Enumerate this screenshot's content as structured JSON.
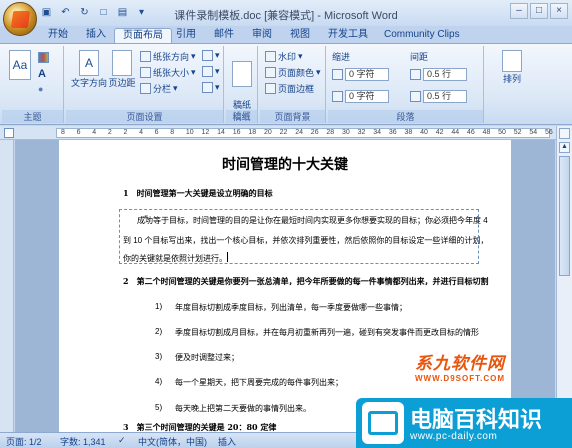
{
  "window": {
    "title": "课件录制模板.doc [兼容模式] - Microsoft Word",
    "controls": [
      "–",
      "□",
      "×"
    ]
  },
  "qat": [
    "save-icon",
    "undo-icon",
    "redo-icon",
    "new-icon",
    "print-icon"
  ],
  "tabs": [
    {
      "label": "开始"
    },
    {
      "label": "插入"
    },
    {
      "label": "页面布局",
      "active": true
    },
    {
      "label": "引用"
    },
    {
      "label": "邮件"
    },
    {
      "label": "审阅"
    },
    {
      "label": "视图"
    },
    {
      "label": "开发工具"
    },
    {
      "label": "Community Clips"
    }
  ],
  "ribbon": {
    "themes_group": {
      "name": "主题",
      "items": [
        "Aa",
        "A",
        "●"
      ]
    },
    "page_setup": {
      "name": "页面设置",
      "text_direction": "文字方向",
      "margins": "页边距",
      "orientation": "纸张方向",
      "size": "纸张大小",
      "columns": "分栏"
    },
    "draft_group": {
      "name": "稿纸",
      "label": "稿纸\n设置"
    },
    "background": {
      "name": "页面背景",
      "watermark": "水印",
      "page_color": "页面颜色",
      "page_border": "页面边框"
    },
    "paragraph": {
      "name": "段落",
      "indent_label": "缩进",
      "spacing_label": "间距",
      "indent_left": "0 字符",
      "indent_right": "0 字符",
      "space_before": "0.5 行",
      "space_after": "0.5 行"
    },
    "arrange": {
      "label": "排列"
    }
  },
  "ruler_numbers": [
    "8",
    "6",
    "4",
    "2",
    "2",
    "4",
    "6",
    "8",
    "10",
    "12",
    "14",
    "16",
    "18",
    "20",
    "22",
    "24",
    "26",
    "28",
    "30",
    "32",
    "34",
    "36",
    "38",
    "40",
    "42",
    "44",
    "46",
    "48",
    "50",
    "52",
    "54",
    "56"
  ],
  "document": {
    "title": "时间管理的十大关键",
    "heading1": "1　时间管理第一大关键是设立明确的目标",
    "para1_line1": "成功等于目标，时间管理的目的是让你在最短时间内实现更多你想要实现的目标；你必须把今年度 4",
    "para1_line2": "到 10 个目标写出来，找出一个核心目标，并依次排列重要性，然后依照你的目标设定一些详细的计划，",
    "para1_line3": "你的关键就是依照计划进行。",
    "heading2": "2　第二个时间管理的关键是你要列一张总清单，把今年所要做的每一件事情都列出来，并进行目标切割",
    "list": [
      {
        "num": "1)",
        "text": "年度目标切割成季度目标，列出清单，每一季度要做哪一些事情；"
      },
      {
        "num": "2)",
        "text": "季度目标切割成月目标，并在每月初重新再列一遍，碰到有突发事件而更改目标的情形"
      },
      {
        "num": "3)",
        "text": "便及时调整过来；"
      },
      {
        "num": "4)",
        "text": "每一个星期天，把下周要完成的每件事列出来；"
      },
      {
        "num": "5)",
        "text": "每天晚上把第二天要做的事情列出来。"
      }
    ],
    "heading3": "3　第三个时间管理的关键是 20：80 定律"
  },
  "status": {
    "page": "页面: 1/2",
    "words": "字数: 1,341",
    "lang": "中文(简体，中国)",
    "mode": "插入"
  },
  "watermarks": {
    "wm1_text": "系九软件网",
    "wm1_url": "WWW.D9SOFT.COM",
    "wm2_text": "电脑百科知识",
    "wm2_url": "www.pc-daily.com"
  }
}
